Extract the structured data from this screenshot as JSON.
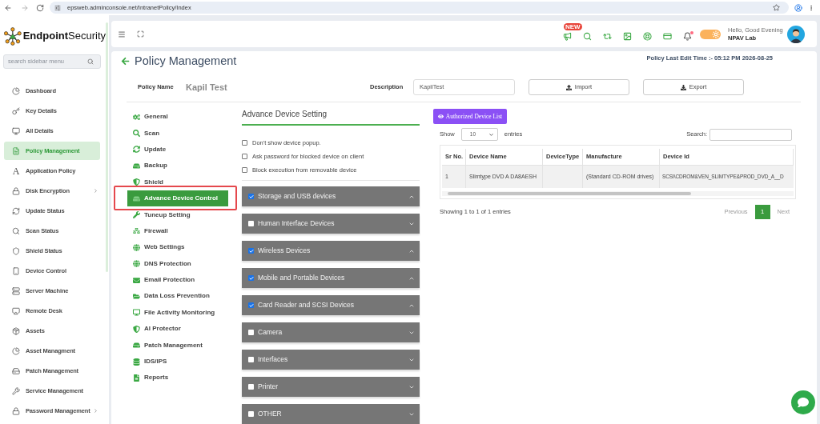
{
  "browser": {
    "url": "epsweb.adminconsole.net/IntranetPolicy/Index"
  },
  "sidebar": {
    "logo": {
      "bold": "Endpoint",
      "regular": "Security"
    },
    "search": {
      "placeholder": "search sidebar menu"
    },
    "items": [
      {
        "label": "Dashboard",
        "selected": false,
        "submenu": false
      },
      {
        "label": "Key Details",
        "selected": false,
        "submenu": false
      },
      {
        "label": "All Details",
        "selected": false,
        "submenu": false
      },
      {
        "label": "Policy Management",
        "selected": true,
        "submenu": false
      },
      {
        "label": "Application Policy",
        "glyph": "A",
        "selected": false,
        "submenu": false
      },
      {
        "label": "Disk Encryption",
        "selected": false,
        "submenu": true
      },
      {
        "label": "Update Status",
        "selected": false,
        "submenu": false
      },
      {
        "label": "Scan Status",
        "selected": false,
        "submenu": false
      },
      {
        "label": "Shield Status",
        "selected": false,
        "submenu": false
      },
      {
        "label": "Device Control",
        "selected": false,
        "submenu": false
      },
      {
        "label": "Server Machine",
        "selected": false,
        "submenu": false
      },
      {
        "label": "Remote Desk",
        "selected": false,
        "submenu": false
      },
      {
        "label": "Assets",
        "selected": false,
        "submenu": false
      },
      {
        "label": "Asset Managment",
        "selected": false,
        "submenu": false
      },
      {
        "label": "Patch Management",
        "selected": false,
        "submenu": false
      },
      {
        "label": "Service Management",
        "selected": false,
        "submenu": false
      },
      {
        "label": "Password Management",
        "selected": false,
        "submenu": true
      }
    ]
  },
  "header": {
    "new_badge": "NEW",
    "notification_dot": true,
    "theme_toggle": {
      "on": true
    },
    "greeting": "Hello, Good Evening",
    "user": "NPAV Lab"
  },
  "page": {
    "title": "Policy Management",
    "last_edit": "Policy Last Edit Time :- 05:12 PM 2026-08-25",
    "policy_name": {
      "label": "Policy Name",
      "value": "Kapil Test"
    },
    "description": {
      "label": "Description",
      "value": "KapilTest"
    },
    "buttons": [
      "Import",
      "Export"
    ]
  },
  "policy_menu": [
    {
      "label": "General",
      "selected": false,
      "outlined": false
    },
    {
      "label": "Scan",
      "selected": false,
      "outlined": false
    },
    {
      "label": "Update",
      "selected": false,
      "outlined": false
    },
    {
      "label": "Backup",
      "selected": false,
      "outlined": false
    },
    {
      "label": "Shield",
      "selected": false,
      "outlined": false
    },
    {
      "label": "Advance Device Control",
      "selected": true,
      "outlined": true
    },
    {
      "label": "Tuneup Setting",
      "selected": false,
      "outlined": false
    },
    {
      "label": "Firewall",
      "selected": false,
      "outlined": false
    },
    {
      "label": "Web Settings",
      "selected": false,
      "outlined": false
    },
    {
      "label": "DNS Protection",
      "selected": false,
      "outlined": false
    },
    {
      "label": "Email Protection",
      "selected": false,
      "outlined": false
    },
    {
      "label": "Data Loss Prevention",
      "selected": false,
      "outlined": false
    },
    {
      "label": "File Activity Monitoring",
      "selected": false,
      "outlined": false
    },
    {
      "label": "AI Protector",
      "selected": false,
      "outlined": false
    },
    {
      "label": "Patch Management",
      "selected": false,
      "outlined": false
    },
    {
      "label": "IDS/IPS",
      "selected": false,
      "outlined": false
    },
    {
      "label": "Reports",
      "selected": false,
      "outlined": false
    }
  ],
  "device_settings": {
    "title": "Advance Device Setting",
    "options": [
      {
        "label": "Don't show device popup.",
        "checked": false
      },
      {
        "label": "Ask password for blocked device on client",
        "checked": false
      },
      {
        "label": "Block execution from removable device",
        "checked": false
      }
    ],
    "categories": [
      {
        "label": "Storage and USB devices",
        "checked": true,
        "expanded": true
      },
      {
        "label": "Human Interface Devices",
        "checked": false,
        "expanded": false
      },
      {
        "label": "Wireless Devices",
        "checked": true,
        "expanded": true
      },
      {
        "label": "Mobile and Portable Devices",
        "checked": true,
        "expanded": true
      },
      {
        "label": "Card Reader and SCSI Devices",
        "checked": true,
        "expanded": true
      },
      {
        "label": "Camera",
        "checked": false,
        "expanded": false
      },
      {
        "label": "Interfaces",
        "checked": false,
        "expanded": false
      },
      {
        "label": "Printer",
        "checked": false,
        "expanded": false
      },
      {
        "label": "OTHER",
        "checked": false,
        "expanded": false
      }
    ]
  },
  "authorized_devices": {
    "button": "Authorized Device List",
    "show_label": "Show",
    "page_size": "10",
    "entries_label": "entries",
    "search_label": "Search:",
    "columns": [
      "Sr No.",
      "Device Name",
      "DeviceType",
      "Manufacture",
      "Device Id"
    ],
    "rows": [
      {
        "sr_no": "1",
        "device_name": "Slimtype DVD A DA8AESH",
        "manufacture": "(Standard CD-ROM drives)",
        "device_id": "SCSI\\CDROM&VEN_SLIMTYPE&PROD_DVD_A__D"
      }
    ],
    "summary": "Showing 1 to 1 of 1 entries",
    "pagination": [
      {
        "label": "Previous",
        "selected": false,
        "disabled": true
      },
      {
        "label": "1",
        "selected": true,
        "disabled": false
      },
      {
        "label": "Next",
        "selected": false,
        "disabled": true
      }
    ]
  }
}
